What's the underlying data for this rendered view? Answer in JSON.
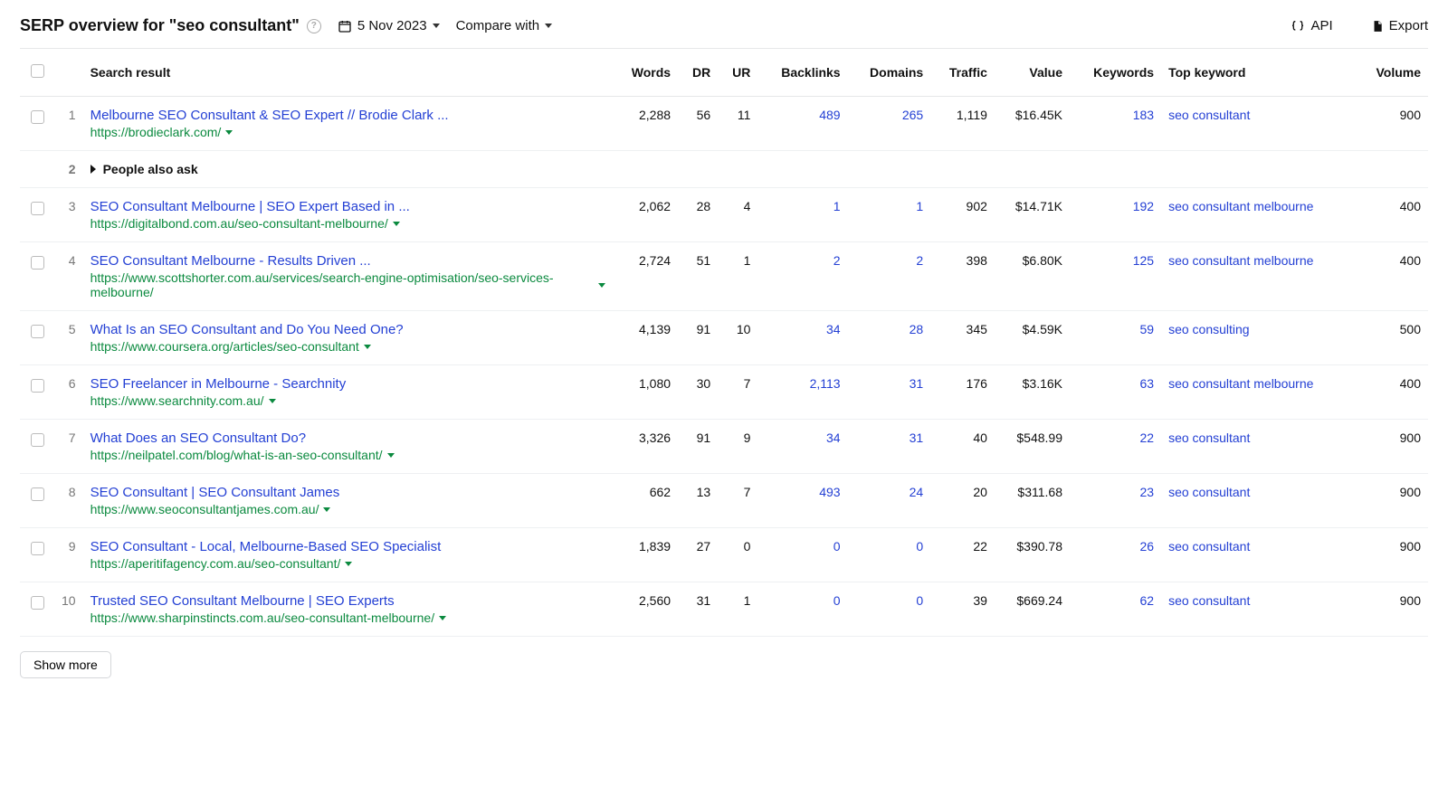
{
  "header": {
    "title": "SERP overview for \"seo consultant\"",
    "date": "5 Nov 2023",
    "compare_label": "Compare with",
    "api_label": "API",
    "export_label": "Export"
  },
  "columns": {
    "search_result": "Search result",
    "words": "Words",
    "dr": "DR",
    "ur": "UR",
    "backlinks": "Backlinks",
    "domains": "Domains",
    "traffic": "Traffic",
    "value": "Value",
    "keywords": "Keywords",
    "top_keyword": "Top keyword",
    "volume": "Volume"
  },
  "paa": {
    "pos": "2",
    "label": "People also ask"
  },
  "rows": [
    {
      "pos": "1",
      "title": "Melbourne SEO Consultant & SEO Expert // Brodie Clark ...",
      "url": "https://brodieclark.com/",
      "words": "2,288",
      "dr": "56",
      "ur": "11",
      "backlinks": "489",
      "domains": "265",
      "traffic": "1,119",
      "value": "$16.45K",
      "keywords": "183",
      "top_keyword": "seo consultant",
      "volume": "900"
    },
    {
      "pos": "3",
      "title": "SEO Consultant Melbourne | SEO Expert Based in ...",
      "url": "https://digitalbond.com.au/seo-consultant-melbourne/",
      "words": "2,062",
      "dr": "28",
      "ur": "4",
      "backlinks": "1",
      "domains": "1",
      "traffic": "902",
      "value": "$14.71K",
      "keywords": "192",
      "top_keyword": "seo consultant melbourne",
      "volume": "400"
    },
    {
      "pos": "4",
      "title": "SEO Consultant Melbourne - Results Driven ...",
      "url": "https://www.scottshorter.com.au/services/search-engine-optimisation/seo-services-melbourne/",
      "words": "2,724",
      "dr": "51",
      "ur": "1",
      "backlinks": "2",
      "domains": "2",
      "traffic": "398",
      "value": "$6.80K",
      "keywords": "125",
      "top_keyword": "seo consultant melbourne",
      "volume": "400"
    },
    {
      "pos": "5",
      "title": "What Is an SEO Consultant and Do You Need One?",
      "url": "https://www.coursera.org/articles/seo-consultant",
      "words": "4,139",
      "dr": "91",
      "ur": "10",
      "backlinks": "34",
      "domains": "28",
      "traffic": "345",
      "value": "$4.59K",
      "keywords": "59",
      "top_keyword": "seo consulting",
      "volume": "500"
    },
    {
      "pos": "6",
      "title": "SEO Freelancer in Melbourne - Searchnity",
      "url": "https://www.searchnity.com.au/",
      "words": "1,080",
      "dr": "30",
      "ur": "7",
      "backlinks": "2,113",
      "domains": "31",
      "traffic": "176",
      "value": "$3.16K",
      "keywords": "63",
      "top_keyword": "seo consultant melbourne",
      "volume": "400"
    },
    {
      "pos": "7",
      "title": "What Does an SEO Consultant Do?",
      "url": "https://neilpatel.com/blog/what-is-an-seo-consultant/",
      "words": "3,326",
      "dr": "91",
      "ur": "9",
      "backlinks": "34",
      "domains": "31",
      "traffic": "40",
      "value": "$548.99",
      "keywords": "22",
      "top_keyword": "seo consultant",
      "volume": "900"
    },
    {
      "pos": "8",
      "title": "SEO Consultant | SEO Consultant James",
      "url": "https://www.seoconsultantjames.com.au/",
      "words": "662",
      "dr": "13",
      "ur": "7",
      "backlinks": "493",
      "domains": "24",
      "traffic": "20",
      "value": "$311.68",
      "keywords": "23",
      "top_keyword": "seo consultant",
      "volume": "900"
    },
    {
      "pos": "9",
      "title": "SEO Consultant - Local, Melbourne-Based SEO Specialist",
      "url": "https://aperitifagency.com.au/seo-consultant/",
      "words": "1,839",
      "dr": "27",
      "ur": "0",
      "backlinks": "0",
      "domains": "0",
      "traffic": "22",
      "value": "$390.78",
      "keywords": "26",
      "top_keyword": "seo consultant",
      "volume": "900"
    },
    {
      "pos": "10",
      "title": "Trusted SEO Consultant Melbourne | SEO Experts",
      "url": "https://www.sharpinstincts.com.au/seo-consultant-melbourne/",
      "words": "2,560",
      "dr": "31",
      "ur": "1",
      "backlinks": "0",
      "domains": "0",
      "traffic": "39",
      "value": "$669.24",
      "keywords": "62",
      "top_keyword": "seo consultant",
      "volume": "900"
    }
  ],
  "show_more": "Show more"
}
